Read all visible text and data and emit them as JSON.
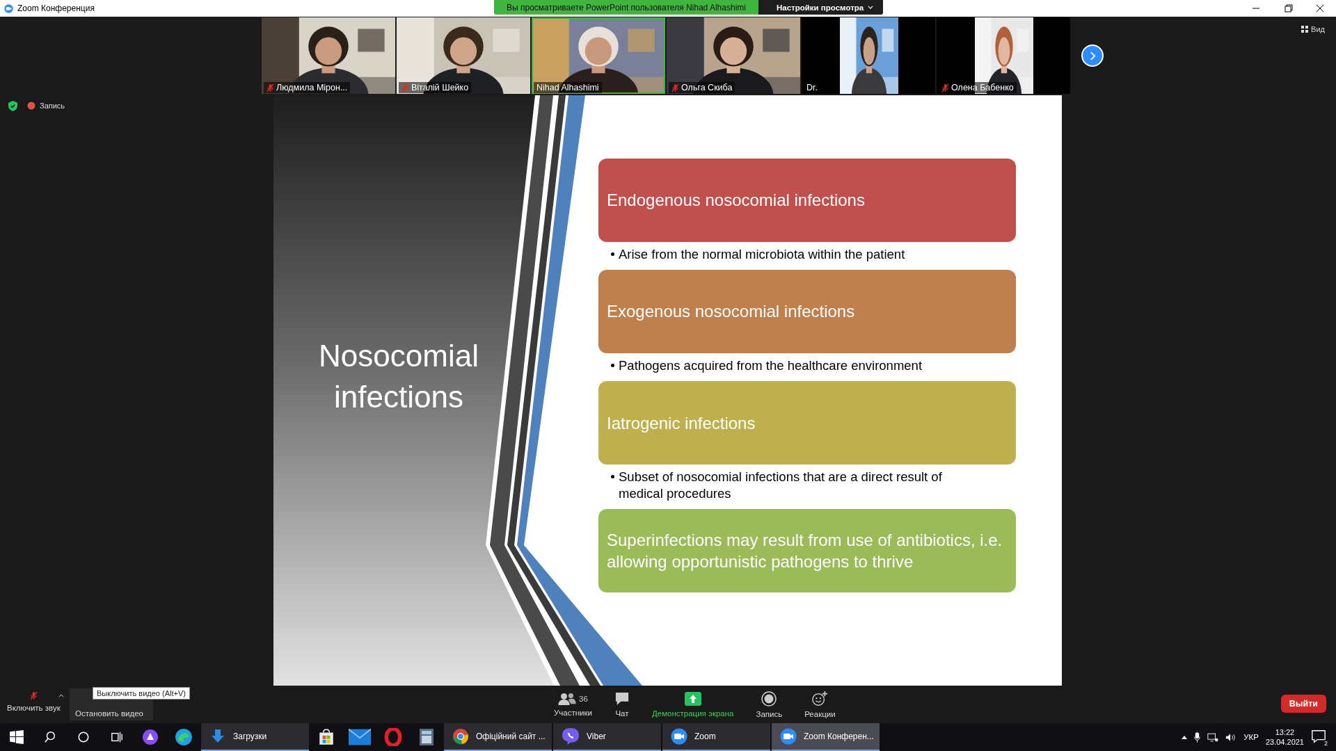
{
  "window": {
    "title": "Zoom Конференция"
  },
  "banner": {
    "text": "Вы просматриваете PowerPoint пользователя Nihad Alhashimi",
    "view_options": "Настройки просмотра"
  },
  "participants": [
    {
      "name": "Людмила Мірон...",
      "muted": true,
      "speaking": false,
      "kind": "video"
    },
    {
      "name": "Віталій Шейко",
      "muted": true,
      "speaking": false,
      "kind": "video"
    },
    {
      "name": "Nihad Alhashimi",
      "muted": false,
      "speaking": true,
      "kind": "video"
    },
    {
      "name": "Ольга Скиба",
      "muted": true,
      "speaking": false,
      "kind": "video"
    },
    {
      "name": "Dr.",
      "muted": false,
      "speaking": false,
      "kind": "avatar"
    },
    {
      "name": "Олена Бабенко",
      "muted": true,
      "speaking": false,
      "kind": "avatar"
    }
  ],
  "view_button": "Вид",
  "recording_label": "Запись",
  "slide": {
    "title": "Nosocomial infections",
    "items": [
      {
        "kind": "box",
        "text": "Endogenous nosocomial infections",
        "color": "#c0504d"
      },
      {
        "kind": "bullet",
        "text": "Arise from the normal microbiota within the patient"
      },
      {
        "kind": "box",
        "text": "Exogenous nosocomial infections",
        "color": "#c0804d"
      },
      {
        "kind": "bullet",
        "text": "Pathogens acquired from the healthcare environment"
      },
      {
        "kind": "box",
        "text": "Iatrogenic infections",
        "color": "#bfb04f"
      },
      {
        "kind": "bullet",
        "text": "Subset of nosocomial infections that are a direct result of medical procedures"
      },
      {
        "kind": "box",
        "text": "Superinfections may result from use of antibiotics, i.e. allowing opportunistic pathogens to thrive",
        "color": "#9bbb59"
      }
    ]
  },
  "toolbar": {
    "unmute": "Включить звук",
    "stop_video": "Остановить видео",
    "tooltip": "Выключить видео (Alt+V)",
    "items": [
      {
        "kind": "participants",
        "label": "Участники",
        "count": "36"
      },
      {
        "kind": "chat",
        "label": "Чат"
      },
      {
        "kind": "share",
        "label": "Демонстрация экрана"
      },
      {
        "kind": "record",
        "label": "Запись"
      },
      {
        "kind": "reactions",
        "label": "Реакции"
      }
    ],
    "leave": "Выйти"
  },
  "taskbar": {
    "items": [
      {
        "kind": "windows"
      },
      {
        "kind": "search"
      },
      {
        "kind": "cortana"
      },
      {
        "kind": "taskview"
      },
      {
        "kind": "assistant"
      },
      {
        "kind": "edge"
      },
      {
        "kind": "downloads",
        "label": "Загрузки",
        "selected": false
      },
      {
        "kind": "store"
      },
      {
        "kind": "mail"
      },
      {
        "kind": "opera"
      },
      {
        "kind": "calculator"
      },
      {
        "kind": "chrome",
        "label": "Офіційний сайт ...",
        "selected": false
      },
      {
        "kind": "viber",
        "label": "Viber",
        "selected": false
      },
      {
        "kind": "zoom",
        "label": "Zoom",
        "selected": false
      },
      {
        "kind": "zoom",
        "label": "Zoom Конферен...",
        "selected": true
      }
    ],
    "language": "УКР",
    "time": "13:22",
    "date": "23.04.2021",
    "notifications": "2"
  }
}
